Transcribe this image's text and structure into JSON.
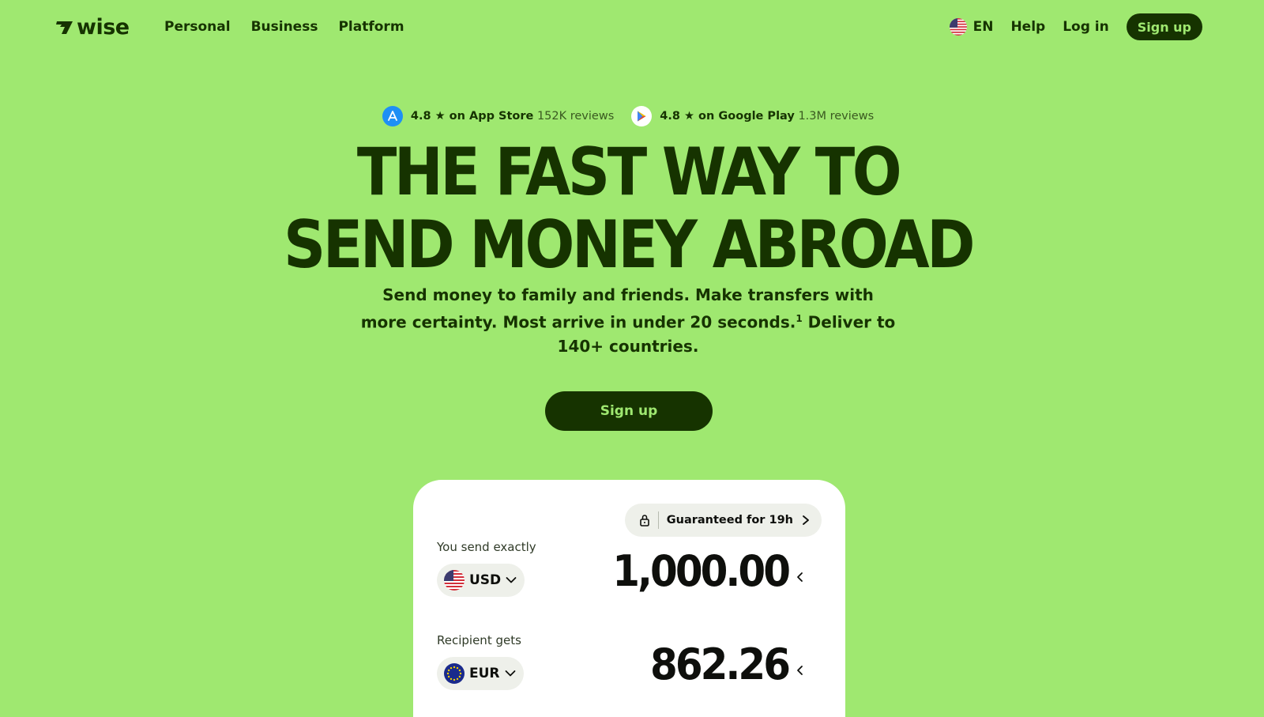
{
  "header": {
    "logo_text": "wise",
    "nav": [
      "Personal",
      "Business",
      "Platform"
    ],
    "language": "EN",
    "help": "Help",
    "login": "Log in",
    "signup": "Sign up"
  },
  "ratings": {
    "app_store": {
      "score": "4.8 ★ on App Store",
      "reviews": "152K reviews"
    },
    "google_play": {
      "score": "4.8 ★ on Google Play",
      "reviews": "1.3M reviews"
    }
  },
  "hero": {
    "title_line1": "THE FAST WAY TO",
    "title_line2": "SEND MONEY ABROAD",
    "subtitle_part1": "Send money to family and friends. Make transfers with more certainty. Most arrive in under 20 seconds.",
    "subtitle_sup": "1",
    "subtitle_part2": " Deliver to 140+ countries.",
    "cta": "Sign up"
  },
  "calculator": {
    "guarantee": "Guaranteed for 19h",
    "send_label": "You send exactly",
    "send_currency": "USD",
    "send_amount": "1,000.00",
    "receive_label": "Recipient gets",
    "receive_currency": "EUR",
    "receive_amount": "862.26"
  },
  "colors": {
    "brand_green": "#9fe870",
    "forest": "#163300"
  },
  "icons": {
    "language_flag": "us-flag-icon",
    "app_store": "app-store-icon",
    "google_play": "google-play-icon",
    "lock": "lock-icon",
    "chevron_right": "chevron-right-icon",
    "chevron_down": "chevron-down-icon",
    "chevron_left": "chevron-left-icon"
  }
}
